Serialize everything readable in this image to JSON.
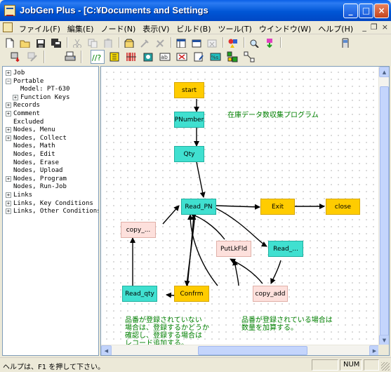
{
  "window": {
    "title": "JobGen Plus - [C:¥Documents and Settings",
    "buttons": {
      "minimize": "_",
      "maximize": "□",
      "close": "×"
    }
  },
  "menubar": {
    "items": [
      "ファイル(F)",
      "編集(E)",
      "ノード(N)",
      "表示(V)",
      "ビルド(B)",
      "ツール(T)",
      "ウインドウ(W)",
      "ヘルプ(H)"
    ],
    "mdi": {
      "minimize": "_",
      "restore": "❐",
      "close": "×"
    }
  },
  "toolbar1": {
    "icons": [
      "new-icon",
      "open-icon",
      "save-icon",
      "save-all-icon",
      "cut-icon",
      "copy-icon",
      "paste-icon",
      "package-icon",
      "build-icon",
      "debug-icon",
      "layout-icon",
      "window-icon",
      "close-window-icon",
      "shapes-icon",
      "find-icon",
      "transfer-icon",
      "device-icon"
    ]
  },
  "toolbar2": {
    "icons": [
      "download-icon",
      "tool-icon",
      "print-icon",
      "condition-icon",
      "menu-node-icon",
      "collect-node-icon",
      "math-node-icon",
      "edit-node-icon",
      "erase-node-icon",
      "upload-node-icon",
      "program-node-icon",
      "runjob-node-icon",
      "link-node-icon",
      "connect-icon"
    ]
  },
  "tree": {
    "items": [
      {
        "label": "Job",
        "exp": "+",
        "indent": 0
      },
      {
        "label": "Portable",
        "exp": "−",
        "indent": 0
      },
      {
        "label": "Model: PT-630",
        "exp": "",
        "indent": 1
      },
      {
        "label": "Function Keys",
        "exp": "+",
        "indent": 1
      },
      {
        "label": "Records",
        "exp": "+",
        "indent": 0
      },
      {
        "label": "Comment",
        "exp": "+",
        "indent": 0
      },
      {
        "label": "Excluded",
        "exp": "",
        "indent": 0
      },
      {
        "label": "Nodes, Menu",
        "exp": "+",
        "indent": 0
      },
      {
        "label": "Nodes, Collect",
        "exp": "+",
        "indent": 0
      },
      {
        "label": "Nodes, Math",
        "exp": "",
        "indent": 0
      },
      {
        "label": "Nodes, Edit",
        "exp": "",
        "indent": 0
      },
      {
        "label": "Nodes, Erase",
        "exp": "",
        "indent": 0
      },
      {
        "label": "Nodes, Upload",
        "exp": "",
        "indent": 0
      },
      {
        "label": "Nodes, Program",
        "exp": "+",
        "indent": 0
      },
      {
        "label": "Nodes, Run-Job",
        "exp": "",
        "indent": 0
      },
      {
        "label": "Links",
        "exp": "+",
        "indent": 0
      },
      {
        "label": "Links, Key Conditions",
        "exp": "+",
        "indent": 0
      },
      {
        "label": "Links, Other Conditions",
        "exp": "+",
        "indent": 0
      }
    ]
  },
  "diagram": {
    "title_note": "在庫データ数収集プログラム",
    "nodes": {
      "start": "start",
      "pnumber": "PNumber",
      "qty": "Qty",
      "read_pn": "Read_PN",
      "exit": "Exit",
      "close": "close",
      "copy": "copy_...",
      "putlkfld": "PutLkFld",
      "read_dots": "Read_...",
      "read_qty": "Read_qty",
      "confrm": "Confrm",
      "copy_add": "copy_add"
    },
    "note_left": "品番が登録されていない\n場合は、登録するかどうか\n確認し、登録する場合は\nレコード追加する。",
    "note_right": "品番が登録されている場合は\n数量を加算する。"
  },
  "colors": {
    "yellow_node": "#ffcc00",
    "teal_node": "#40e0d0",
    "pink_node": "#fde0dc",
    "annotation": "#008000"
  },
  "statusbar": {
    "help_text": "ヘルプは、F1 を押して下さい。",
    "num": "NUM"
  }
}
